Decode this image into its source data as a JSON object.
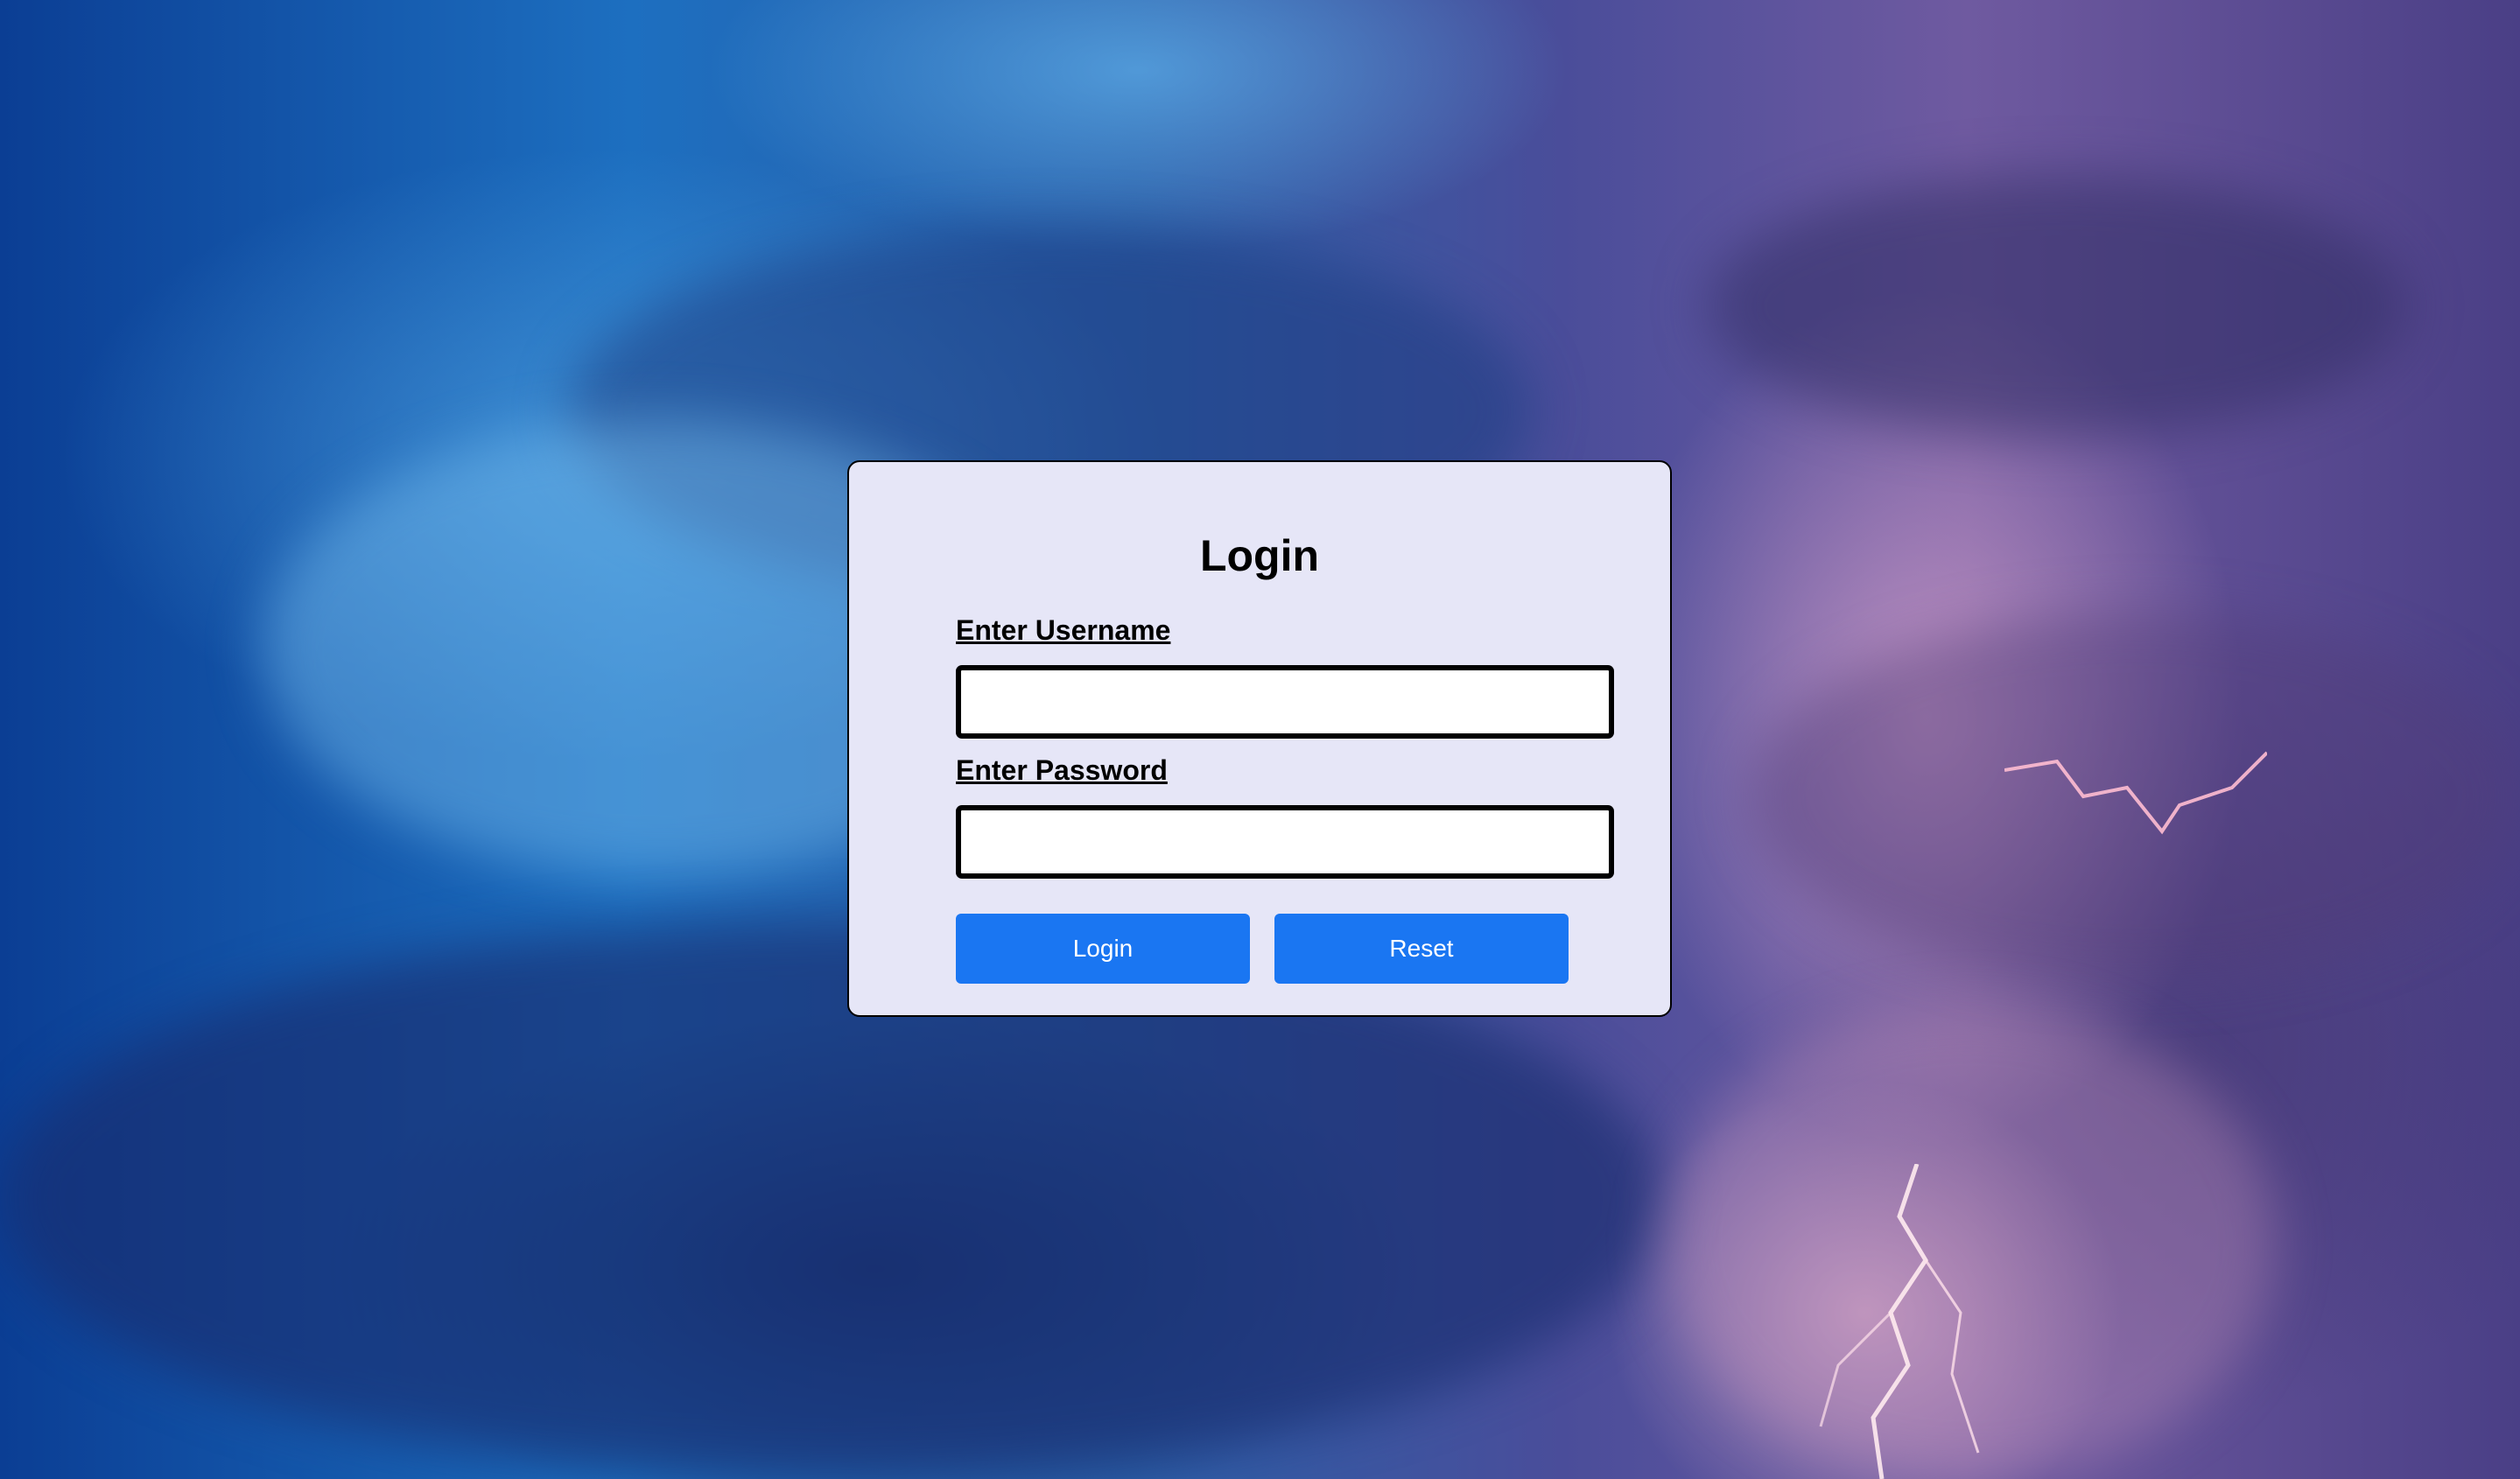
{
  "page": {
    "accent_color": "#1a76f2",
    "card_background": "#e6e6f7"
  },
  "login_form": {
    "title": "Login",
    "username_label": "Enter Username",
    "username_value": "",
    "password_label": "Enter Password",
    "password_value": "",
    "login_button": "Login",
    "reset_button": "Reset"
  }
}
